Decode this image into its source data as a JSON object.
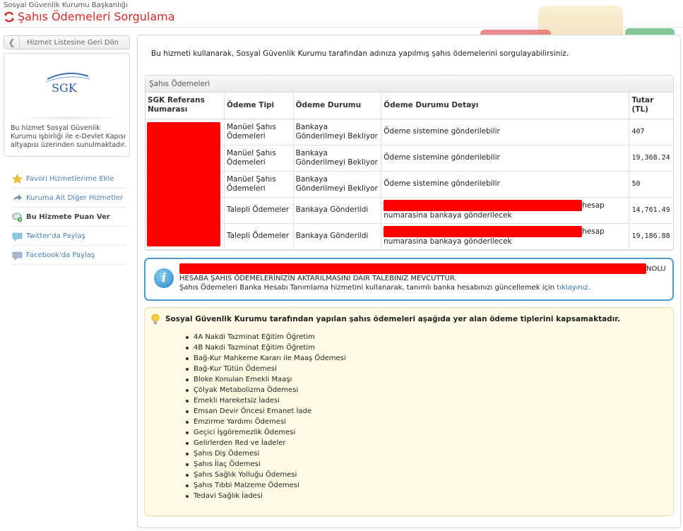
{
  "header": {
    "org_name": "Sosyal Güvenlik Kurumu Başkanlığı",
    "title": "Şahıs Ödemeleri Sorgulama"
  },
  "sidebar": {
    "back_label": "Hizmet Listesine Geri Dön",
    "logo_text": "SGK",
    "agency_text": "Bu hizmet Sosyal Güvenlik Kurumu işbirliği ile e-Devlet Kapısı altyapısı üzerinden sunulmaktadır.",
    "links": [
      {
        "label": "Favori Hizmetlerime Ekle",
        "icon": "star-icon"
      },
      {
        "label": "Kuruma Ait Diğer Hizmetler",
        "icon": "share-arrow-icon"
      },
      {
        "label": "Bu Hizmete Puan Ver",
        "icon": "rate-icon"
      },
      {
        "label": "Twitter'da Paylaş",
        "icon": "twitter-icon"
      },
      {
        "label": "Facebook'da Paylaş",
        "icon": "facebook-icon"
      }
    ]
  },
  "main": {
    "intro": "Bu hizmeti kullanarak, Sosyal Güvenlik Kurumu tarafından adınıza yapılmış şahıs ödemelerini sorgulayabilirsiniz.",
    "table": {
      "title": "Şahıs Ödemeleri",
      "headers": [
        "SGK Referans Numarası",
        "Ödeme Tipi",
        "Ödeme Durumu",
        "Ödeme Durumu Detayı",
        "Tutar (TL)"
      ],
      "rows": [
        {
          "type": "Manüel Şahıs Ödemeleri",
          "status": "Bankaya Gönderilmeyi Bekliyor",
          "detail": "Ödeme sistemine gönderilebilir",
          "amount": "407"
        },
        {
          "type": "Manüel Şahıs Ödemeleri",
          "status": "Bankaya Gönderilmeyi Bekliyor",
          "detail": "Ödeme sistemine gönderilebilir",
          "amount": "19,368.24"
        },
        {
          "type": "Manüel Şahıs Ödemeleri",
          "status": "Bankaya Gönderilmeyi Bekliyor",
          "detail": "Ödeme sistemine gönderilebilir",
          "amount": "50"
        },
        {
          "type": "Talepli Ödemeler",
          "status": "Bankaya Gönderildi",
          "detail_suffix": "hesap",
          "detail_line2": "numarasina bankaya gönderilecek",
          "amount": "14,761.49"
        },
        {
          "type": "Talepli Ödemeler",
          "status": "Bankaya Gönderildi",
          "detail_suffix": "hesap",
          "detail_line2": "numarasina bankaya gönderilecek",
          "amount": "19,186.88"
        }
      ]
    },
    "info": {
      "suffix": "NOLU",
      "line2": "HESABA ŞAHIS ÖDEMELERİNİZİN AKTARILMASINI DAIR TALEBINIZ MEVCUTTUR.",
      "line3": "Şahıs Ödemeleri Banka Hesabı Tanımlama hizmetini kullanarak, tanımlı banka hesabınızı güncellemek için",
      "link": "tıklayınız."
    },
    "note": {
      "heading": "Sosyal Güvenlik Kurumu tarafından yapılan şahıs ödemeleri aşağıda yer alan ödeme tiplerini kapsamaktadır.",
      "items": [
        "4A Nakdi Tazminat Eğitim Öğretim",
        "4B Nakdi Tazminat Eğitim Öğretim",
        "Bağ-Kur Mahkeme Kararı ile Maaş Ödemesi",
        "Bağ-Kur Tütün Ödemesi",
        "Bloke Konulan Emekli Maaşı",
        "Çölyak Metabolizma Ödemesi",
        "Emekli Hareketsiz İadesi",
        "Emsan Devir Öncesi Emanet İade",
        "Emzirme Yardımı Ödemesi",
        "Geçici İşgöremezlik Ödemesi",
        "Gelirlerden Red ve İadeler",
        "Şahıs Diş Ödemesi",
        "Şahıs İlaç Ödemesi",
        "Şahıs Sağlık Yolluğu Ödemesi",
        "Şahıs Tıbbi Malzeme Ödemesi",
        "Tedavi Sağlık İadesi"
      ]
    }
  },
  "colors": {
    "title_red": "#d42b2b",
    "link_blue": "#4a7bb5",
    "info_border": "#4d9ccc",
    "note_bg": "#fffbe4",
    "redaction": "#ff0000"
  }
}
